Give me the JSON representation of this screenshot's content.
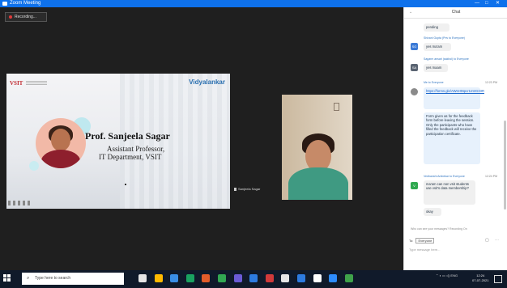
{
  "window": {
    "title": "Zoom Meeting",
    "minimize": "—",
    "maximize": "□",
    "close": "✕"
  },
  "recording": {
    "label": "Recording..."
  },
  "slide": {
    "brand_left": "VSIT",
    "brand_right": "Vidyalankar",
    "name": "Prof. Sanjeela Sagar",
    "position": "Assistant Professor,",
    "department": "IT Department, VSIT"
  },
  "speaker_label": "Sanjeela Sagar",
  "chat": {
    "header": "Chat",
    "messages": [
      {
        "text": "pending"
      },
      {
        "meta": "Shivani Gupta (Priv to Everyone)",
        "avatar": "SG",
        "avatar_color": "#3b7ad6",
        "text": "yes ma'am"
      },
      {
        "meta": "Sagarm ansari (sakhol) to Everyone",
        "avatar": "SA",
        "avatar_color": "#5a6472",
        "text": "yes maam"
      },
      {
        "meta": "Me to Everyone",
        "time": "12:23 PM",
        "link": "https://forms.gle/AWsHtNpcr1mtrG33R",
        "text": "Form given as for the feedback form before leaving the session. Only the participants who have filled the feedback will receive the participation certificate."
      },
      {
        "meta": "Vedhanshi Ambekar to Everyone",
        "time": "12:24 PM",
        "avatar": "V",
        "avatar_color": "#2fa84f",
        "text": "ma'am can non vsit students use vsit's data membership?"
      },
      {
        "text": "okay"
      }
    ],
    "input_hint": "Who can see your messages? Recording On",
    "to_label": "To:",
    "to_value": "Everyone",
    "file_icon": "file-icon",
    "more_icon": "more-icon",
    "input_placeholder": "Type message here..."
  },
  "taskbar": {
    "search_placeholder": "Type here to search",
    "time": "12:24",
    "date": "07-07-2021",
    "icons": [
      "task-view-icon",
      "file-explorer-icon",
      "chrome-icon",
      "edge-icon",
      "app5-icon",
      "app6-icon",
      "app7-icon",
      "app8-icon",
      "app9-icon",
      "app10-icon",
      "app11-icon",
      "app12-icon",
      "zoom-icon",
      "app14-icon"
    ],
    "icon_colors": [
      "#e6e6e6",
      "#ffb900",
      "#3a8ee6",
      "#1aa260",
      "#e25c2a",
      "#32a852",
      "#6b5bd6",
      "#2d7be0",
      "#d03a3a",
      "#e6e6e6",
      "#2d7be0",
      "#ffffff",
      "#2d8cff",
      "#3fa24a"
    ]
  }
}
